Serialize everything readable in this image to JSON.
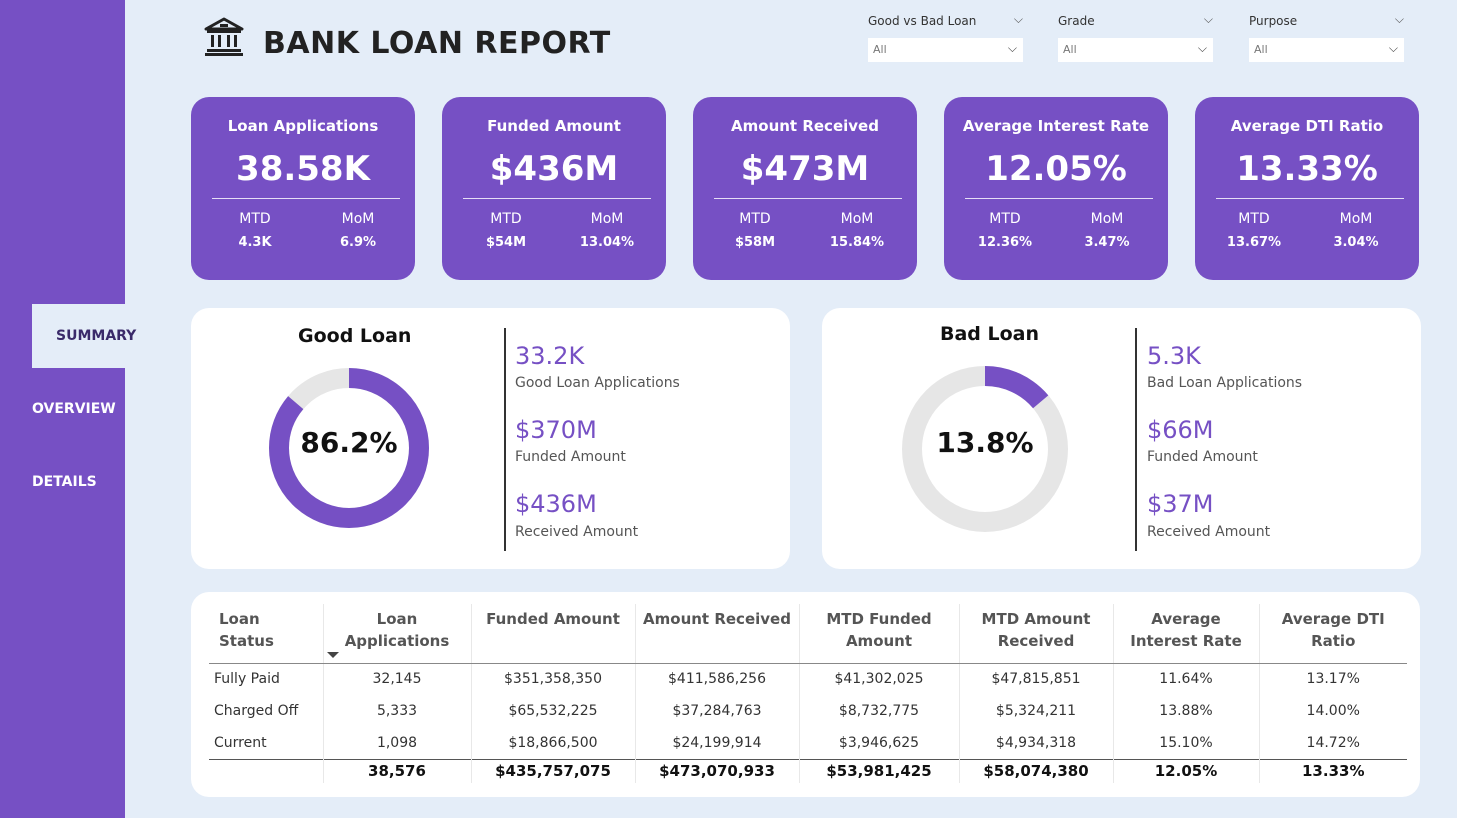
{
  "header": {
    "title": "BANK LOAN REPORT",
    "icon": "bank-icon"
  },
  "sidebar": {
    "items": [
      {
        "label": "SUMMARY",
        "active": true
      },
      {
        "label": "OVERVIEW",
        "active": false
      },
      {
        "label": "DETAILS",
        "active": false
      }
    ]
  },
  "filters": [
    {
      "label": "Good vs Bad Loan",
      "value": "All"
    },
    {
      "label": "Grade",
      "value": "All"
    },
    {
      "label": "Purpose",
      "value": "All"
    }
  ],
  "kpis": [
    {
      "title": "Loan Applications",
      "value": "38.58K",
      "mtd_label": "MTD",
      "mtd": "4.3K",
      "mom_label": "MoM",
      "mom": "6.9%"
    },
    {
      "title": "Funded Amount",
      "value": "$436M",
      "mtd_label": "MTD",
      "mtd": "$54M",
      "mom_label": "MoM",
      "mom": "13.04%"
    },
    {
      "title": "Amount Received",
      "value": "$473M",
      "mtd_label": "MTD",
      "mtd": "$58M",
      "mom_label": "MoM",
      "mom": "15.84%"
    },
    {
      "title": "Average Interest Rate",
      "value": "12.05%",
      "mtd_label": "MTD",
      "mtd": "12.36%",
      "mom_label": "MoM",
      "mom": "3.47%"
    },
    {
      "title": "Average DTI Ratio",
      "value": "13.33%",
      "mtd_label": "MTD",
      "mtd": "13.67%",
      "mom_label": "MoM",
      "mom": "3.04%"
    }
  ],
  "good_loan": {
    "title": "Good Loan",
    "percent_label": "86.2%",
    "percent": 86.2,
    "stats": [
      {
        "value": "33.2K",
        "label": "Good Loan Applications"
      },
      {
        "value": "$370M",
        "label": "Funded Amount"
      },
      {
        "value": "$436M",
        "label": "Received Amount"
      }
    ]
  },
  "bad_loan": {
    "title": "Bad Loan",
    "percent_label": "13.8%",
    "percent": 13.8,
    "stats": [
      {
        "value": "5.3K",
        "label": "Bad Loan Applications"
      },
      {
        "value": "$66M",
        "label": "Funded Amount"
      },
      {
        "value": "$37M",
        "label": "Received Amount"
      }
    ]
  },
  "colors": {
    "accent": "#7650c4",
    "background": "#e4edf8",
    "track": "#e6e6e6"
  },
  "table": {
    "headers": [
      "Loan Status",
      "Loan Applications",
      "Funded Amount",
      "Amount Received",
      "MTD Funded Amount",
      "MTD Amount Received",
      "Average Interest Rate",
      "Average DTI Ratio"
    ],
    "rows": [
      [
        "Fully Paid",
        "32,145",
        "$351,358,350",
        "$411,586,256",
        "$41,302,025",
        "$47,815,851",
        "11.64%",
        "13.17%"
      ],
      [
        "Charged Off",
        "5,333",
        "$65,532,225",
        "$37,284,763",
        "$8,732,775",
        "$5,324,211",
        "13.88%",
        "14.00%"
      ],
      [
        "Current",
        "1,098",
        "$18,866,500",
        "$24,199,914",
        "$3,946,625",
        "$4,934,318",
        "15.10%",
        "14.72%"
      ]
    ],
    "total": [
      "",
      "38,576",
      "$435,757,075",
      "$473,070,933",
      "$53,981,425",
      "$58,074,380",
      "12.05%",
      "13.33%"
    ]
  }
}
